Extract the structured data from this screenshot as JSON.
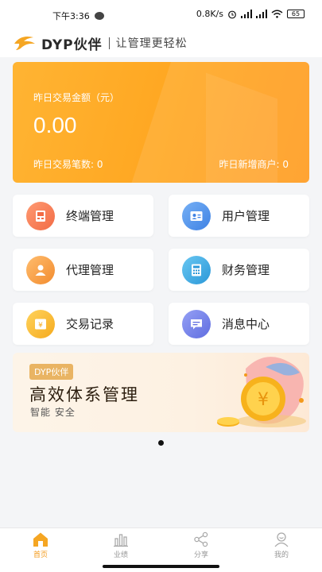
{
  "status_bar": {
    "time": "下午3:36",
    "network_speed": "0.8K/s",
    "battery": "65"
  },
  "header": {
    "brand": "DYP伙伴",
    "slogan": "让管理更轻松"
  },
  "stats": {
    "label": "昨日交易金额（元）",
    "amount": "0.00",
    "count_label": "昨日交易笔数: 0",
    "merchants_label": "昨日新增商户: 0"
  },
  "menu": [
    {
      "label": "终端管理",
      "icon": "terminal-icon",
      "color": "#f57b4f"
    },
    {
      "label": "用户管理",
      "icon": "user-card-icon",
      "color": "#4a8fe8"
    },
    {
      "label": "代理管理",
      "icon": "agent-icon",
      "color": "#f59a3a"
    },
    {
      "label": "财务管理",
      "icon": "calculator-icon",
      "color": "#3aa9e0"
    },
    {
      "label": "交易记录",
      "icon": "yen-icon",
      "color": "#f7b62e"
    },
    {
      "label": "消息中心",
      "icon": "message-icon",
      "color": "#6f7ce8"
    }
  ],
  "banner": {
    "tag": "DYP伙伴",
    "title": "高效体系管理",
    "subtitle": "智能  安全"
  },
  "tabs": [
    {
      "label": "首页",
      "icon": "home-icon",
      "active": true
    },
    {
      "label": "业绩",
      "icon": "bar-chart-icon",
      "active": false
    },
    {
      "label": "分享",
      "icon": "share-icon",
      "active": false
    },
    {
      "label": "我的",
      "icon": "profile-icon",
      "active": false
    }
  ],
  "colors": {
    "accent": "#f39a1b",
    "card_orange": "#ffab28"
  }
}
